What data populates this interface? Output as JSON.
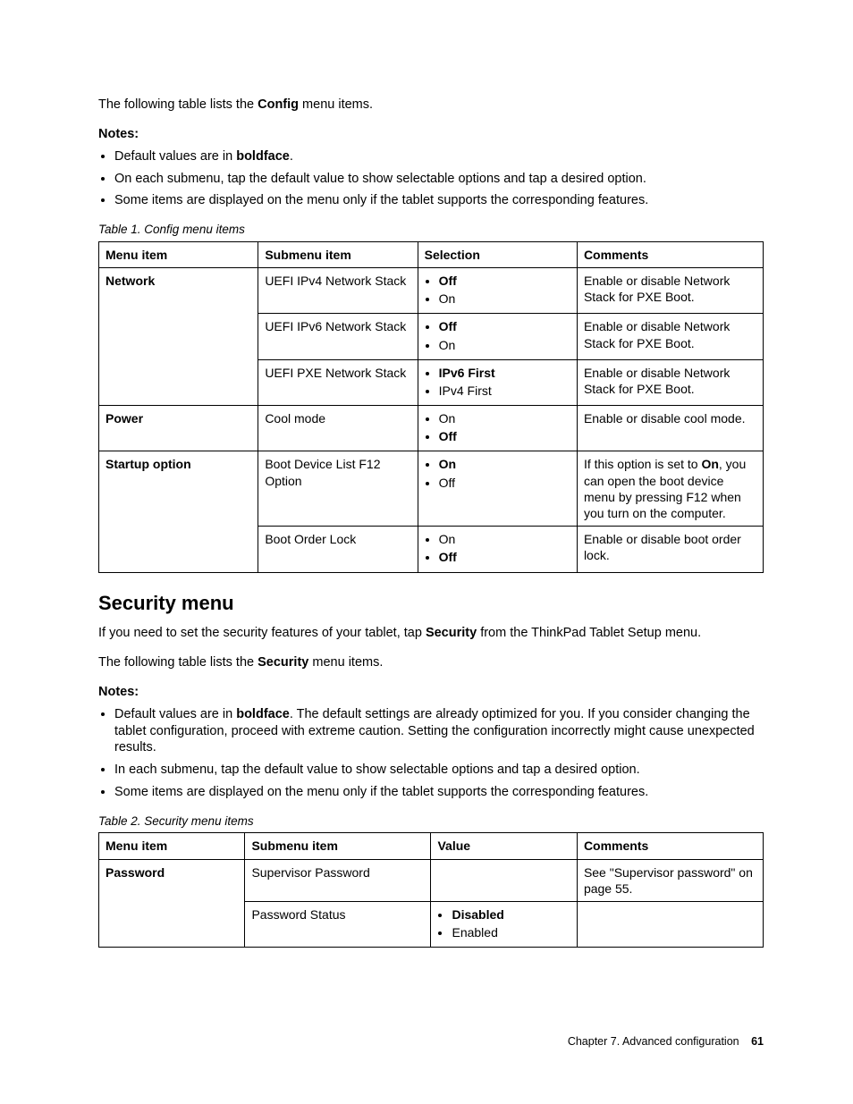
{
  "intro1_pre": "The following table lists the ",
  "intro1_bold": "Config",
  "intro1_post": " menu items.",
  "notes_label": "Notes:",
  "notes1": {
    "i1_pre": "Default values are in ",
    "i1_bold": "boldface",
    "i1_post": ".",
    "i2": "On each submenu, tap the default value to show selectable options and tap a desired option.",
    "i3": "Some items are displayed on the menu only if the tablet supports the corresponding features."
  },
  "table1_caption": "Table 1.  Config menu items",
  "t1_headers": {
    "c1": "Menu item",
    "c2": "Submenu item",
    "c3": "Selection",
    "c4": "Comments"
  },
  "t1": {
    "network_label": "Network",
    "r1_sub": "UEFI IPv4 Network Stack",
    "r1_s1": "Off",
    "r1_s2": "On",
    "r1_comment": "Enable or disable Network Stack for PXE Boot.",
    "r2_sub": "UEFI IPv6 Network Stack",
    "r2_s1": "Off",
    "r2_s2": "On",
    "r2_comment": "Enable or disable Network Stack for PXE Boot.",
    "r3_sub": "UEFI PXE Network Stack",
    "r3_s1": "IPv6 First",
    "r3_s2": "IPv4 First",
    "r3_comment": "Enable or disable Network Stack for PXE Boot.",
    "power_label": "Power",
    "r4_sub": "Cool mode",
    "r4_s1": "On",
    "r4_s2": "Off",
    "r4_comment": "Enable or disable cool mode.",
    "startup_label": "Startup option",
    "r5_sub": "Boot Device List F12 Option",
    "r5_s1": "On",
    "r5_s2": "Off",
    "r5_comment_pre": "If this option is set to ",
    "r5_comment_bold": "On",
    "r5_comment_post": ", you can open the boot device menu by pressing F12 when you turn on the computer.",
    "r6_sub": "Boot Order Lock",
    "r6_s1": "On",
    "r6_s2": "Off",
    "r6_comment": "Enable or disable boot order lock."
  },
  "section2_heading": "Security menu",
  "sec2_intro_pre": "If you need to set the security features of your tablet, tap ",
  "sec2_intro_bold": "Security",
  "sec2_intro_post": " from the ThinkPad Tablet Setup menu.",
  "sec2_intro2_pre": "The following table lists the ",
  "sec2_intro2_bold": "Security",
  "sec2_intro2_post": " menu items.",
  "notes2": {
    "i1_pre": "Default values are in ",
    "i1_bold": "boldface",
    "i1_post": ".  The default settings are already optimized for you.  If you consider changing the tablet configuration, proceed with extreme caution.  Setting the configuration incorrectly might cause unexpected results.",
    "i2": "In each submenu, tap the default value to show selectable options and tap a desired option.",
    "i3": "Some items are displayed on the menu only if the tablet supports the corresponding features."
  },
  "table2_caption": "Table 2.  Security menu items",
  "t2_headers": {
    "c1": "Menu item",
    "c2": "Submenu item",
    "c3": "Value",
    "c4": "Comments"
  },
  "t2": {
    "password_label": "Password",
    "r1_sub": "Supervisor Password",
    "r1_comment": "See  \"Supervisor password\" on page 55.",
    "r2_sub": "Password Status",
    "r2_v1": "Disabled",
    "r2_v2": "Enabled"
  },
  "footer_chapter": "Chapter 7.  Advanced configuration",
  "footer_page": "61"
}
